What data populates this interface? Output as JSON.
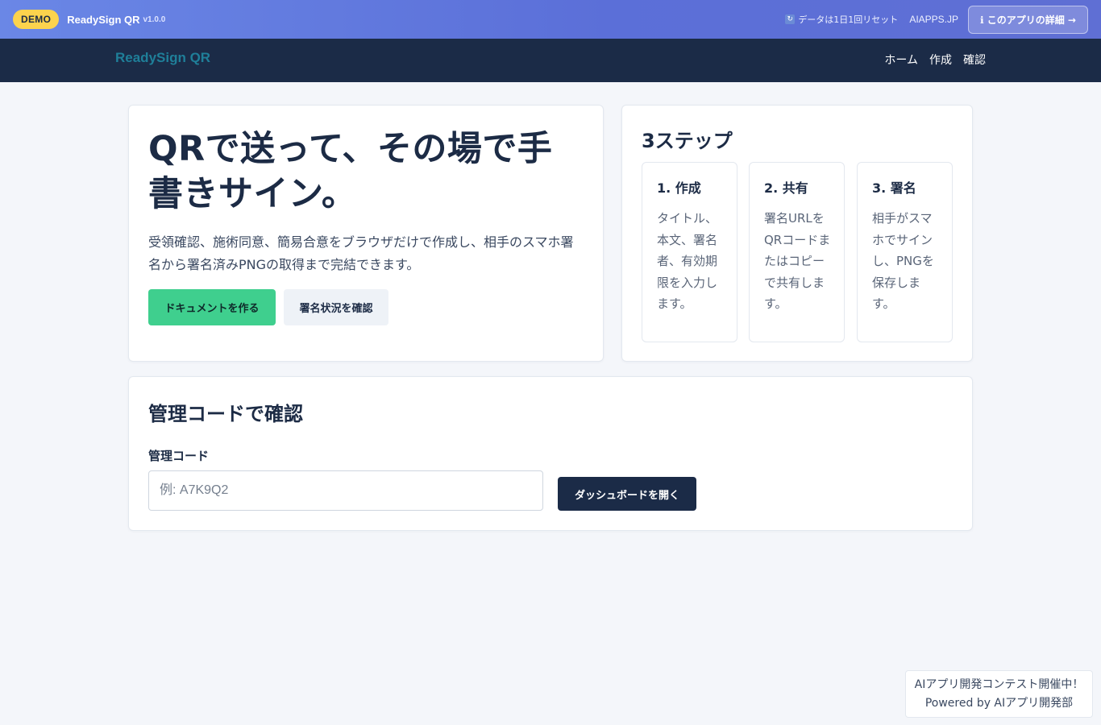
{
  "demo_bar": {
    "badge": "DEMO",
    "app_name": "ReadySign QR",
    "version": "v1.0.0",
    "reset_icon": "refresh-icon",
    "reset_note": "データは1日1回リセット",
    "aiapps_link": "AIAPPS.JP",
    "details_button": "ℹ このアプリの詳細 →"
  },
  "nav": {
    "brand": "ReadySign QR",
    "links": [
      "ホーム",
      "作成",
      "確認"
    ]
  },
  "hero": {
    "title": "QRで送って、その場で手書きサイン。",
    "description": "受領確認、施術同意、簡易合意をブラウザだけで作成し、相手のスマホ署名から署名済みPNGの取得まで完結できます。",
    "primary_button": "ドキュメントを作る",
    "secondary_button": "署名状況を確認"
  },
  "steps": {
    "title": "3ステップ",
    "items": [
      {
        "title": "1. 作成",
        "text": "タイトル、本文、署名者、有効期限を入力します。"
      },
      {
        "title": "2. 共有",
        "text": "署名URLをQRコードまたはコピーで共有します。"
      },
      {
        "title": "3. 署名",
        "text": "相手がスマホでサインし、PNGを保存します。"
      }
    ]
  },
  "lookup": {
    "title": "管理コードで確認",
    "field_label": "管理コード",
    "input_value": "",
    "input_placeholder": "例: A7K9Q2",
    "button": "ダッシュボードを開く"
  },
  "footer_box": {
    "line1": "AIアプリ開発コンテスト開催中！",
    "line2": "Powered by AIアプリ開発部"
  },
  "colors": {
    "accent_green": "#3fcf8e",
    "navy": "#1b2b47",
    "demo_yellow": "#fcd34d",
    "brand_teal": "#1f7f99"
  }
}
